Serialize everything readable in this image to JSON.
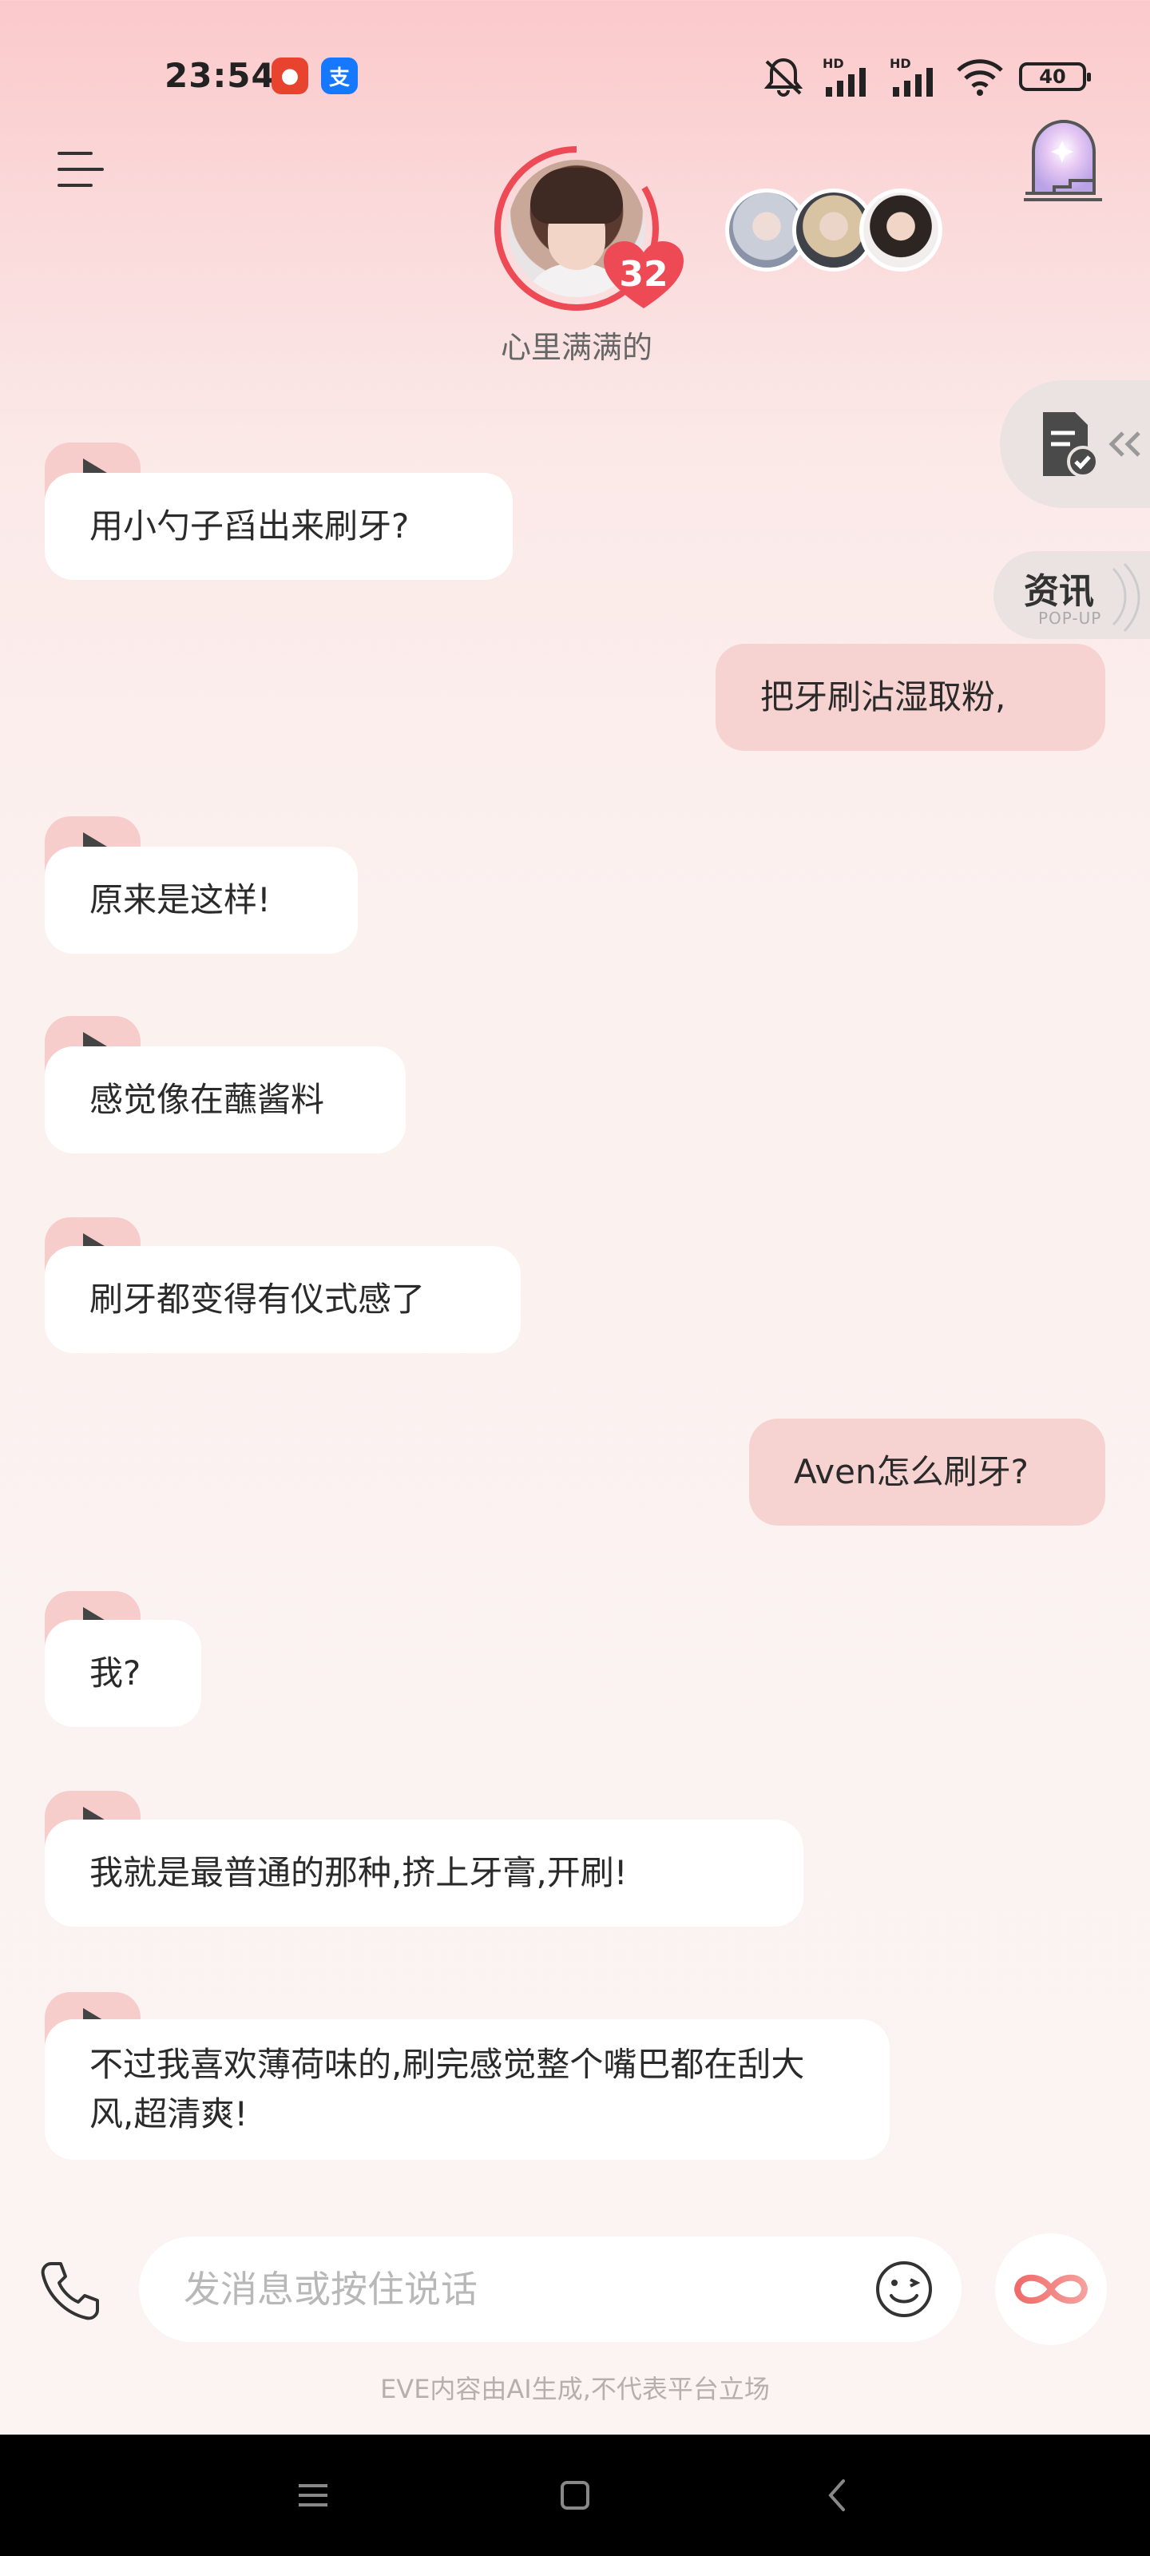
{
  "status_bar": {
    "time": "23:54",
    "battery": "40",
    "app_badges": [
      "app-red-icon",
      "alipay-icon"
    ]
  },
  "header": {
    "avatar_caption": "心里满满的",
    "heart_count": "32"
  },
  "side": {
    "news_title": "资讯",
    "news_sub": "POP-UP"
  },
  "messages": [
    {
      "role": "ai",
      "text": "用小勺子舀出来刷牙?"
    },
    {
      "role": "me",
      "text": "把牙刷沾湿取粉,"
    },
    {
      "role": "ai",
      "text": "原来是这样!"
    },
    {
      "role": "ai",
      "text": "感觉像在蘸酱料"
    },
    {
      "role": "ai",
      "text": "刷牙都变得有仪式感了"
    },
    {
      "role": "me",
      "text": "Aven怎么刷牙?"
    },
    {
      "role": "ai",
      "text": "我?"
    },
    {
      "role": "ai",
      "text": "我就是最普通的那种,挤上牙膏,开刷!"
    },
    {
      "role": "ai",
      "text": "不过我喜欢薄荷味的,刷完感觉整个嘴巴都在刮大风,超清爽!"
    }
  ],
  "composer": {
    "placeholder": "发消息或按住说话"
  },
  "disclaimer": "EVE内容由AI生成,不代表平台立场",
  "colors": {
    "accent": "#ee4a55",
    "user_bubble": "#f6d3d1",
    "play_tab": "#f7cdcc"
  }
}
